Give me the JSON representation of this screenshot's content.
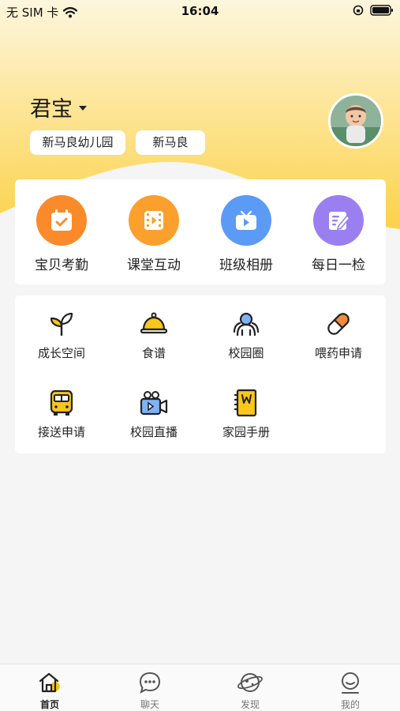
{
  "status_bar": {
    "carrier": "无 SIM 卡",
    "time": "16:04"
  },
  "profile": {
    "child_name": "君宝",
    "school": "新马良幼儿园",
    "class_name": "新马良"
  },
  "main_features": [
    {
      "label": "宝贝考勤",
      "icon": "calendar-check-icon",
      "color": "#fb8a2a"
    },
    {
      "label": "课堂互动",
      "icon": "film-icon",
      "color": "#fba02c"
    },
    {
      "label": "班级相册",
      "icon": "tv-play-icon",
      "color": "#5b9bf6"
    },
    {
      "label": "每日一检",
      "icon": "checklist-edit-icon",
      "color": "#9a7ff0"
    }
  ],
  "sub_features": [
    {
      "label": "成长空间",
      "icon": "sprout-icon"
    },
    {
      "label": "食谱",
      "icon": "cloche-icon"
    },
    {
      "label": "校园圈",
      "icon": "people-circle-icon"
    },
    {
      "label": "喂药申请",
      "icon": "pill-icon"
    },
    {
      "label": "接送申请",
      "icon": "school-bus-icon"
    },
    {
      "label": "校园直播",
      "icon": "video-camera-icon"
    },
    {
      "label": "家园手册",
      "icon": "handbook-icon"
    }
  ],
  "tab_bar": {
    "tabs": [
      {
        "label": "首页",
        "icon": "home-icon",
        "active": true
      },
      {
        "label": "聊天",
        "icon": "chat-icon",
        "active": false
      },
      {
        "label": "发现",
        "icon": "planet-icon",
        "active": false
      },
      {
        "label": "我的",
        "icon": "user-icon",
        "active": false
      }
    ]
  },
  "colors": {
    "header_yellow": "#fbd24a",
    "accent_yellow": "#f9c71a",
    "background": "#f5f5f5"
  }
}
